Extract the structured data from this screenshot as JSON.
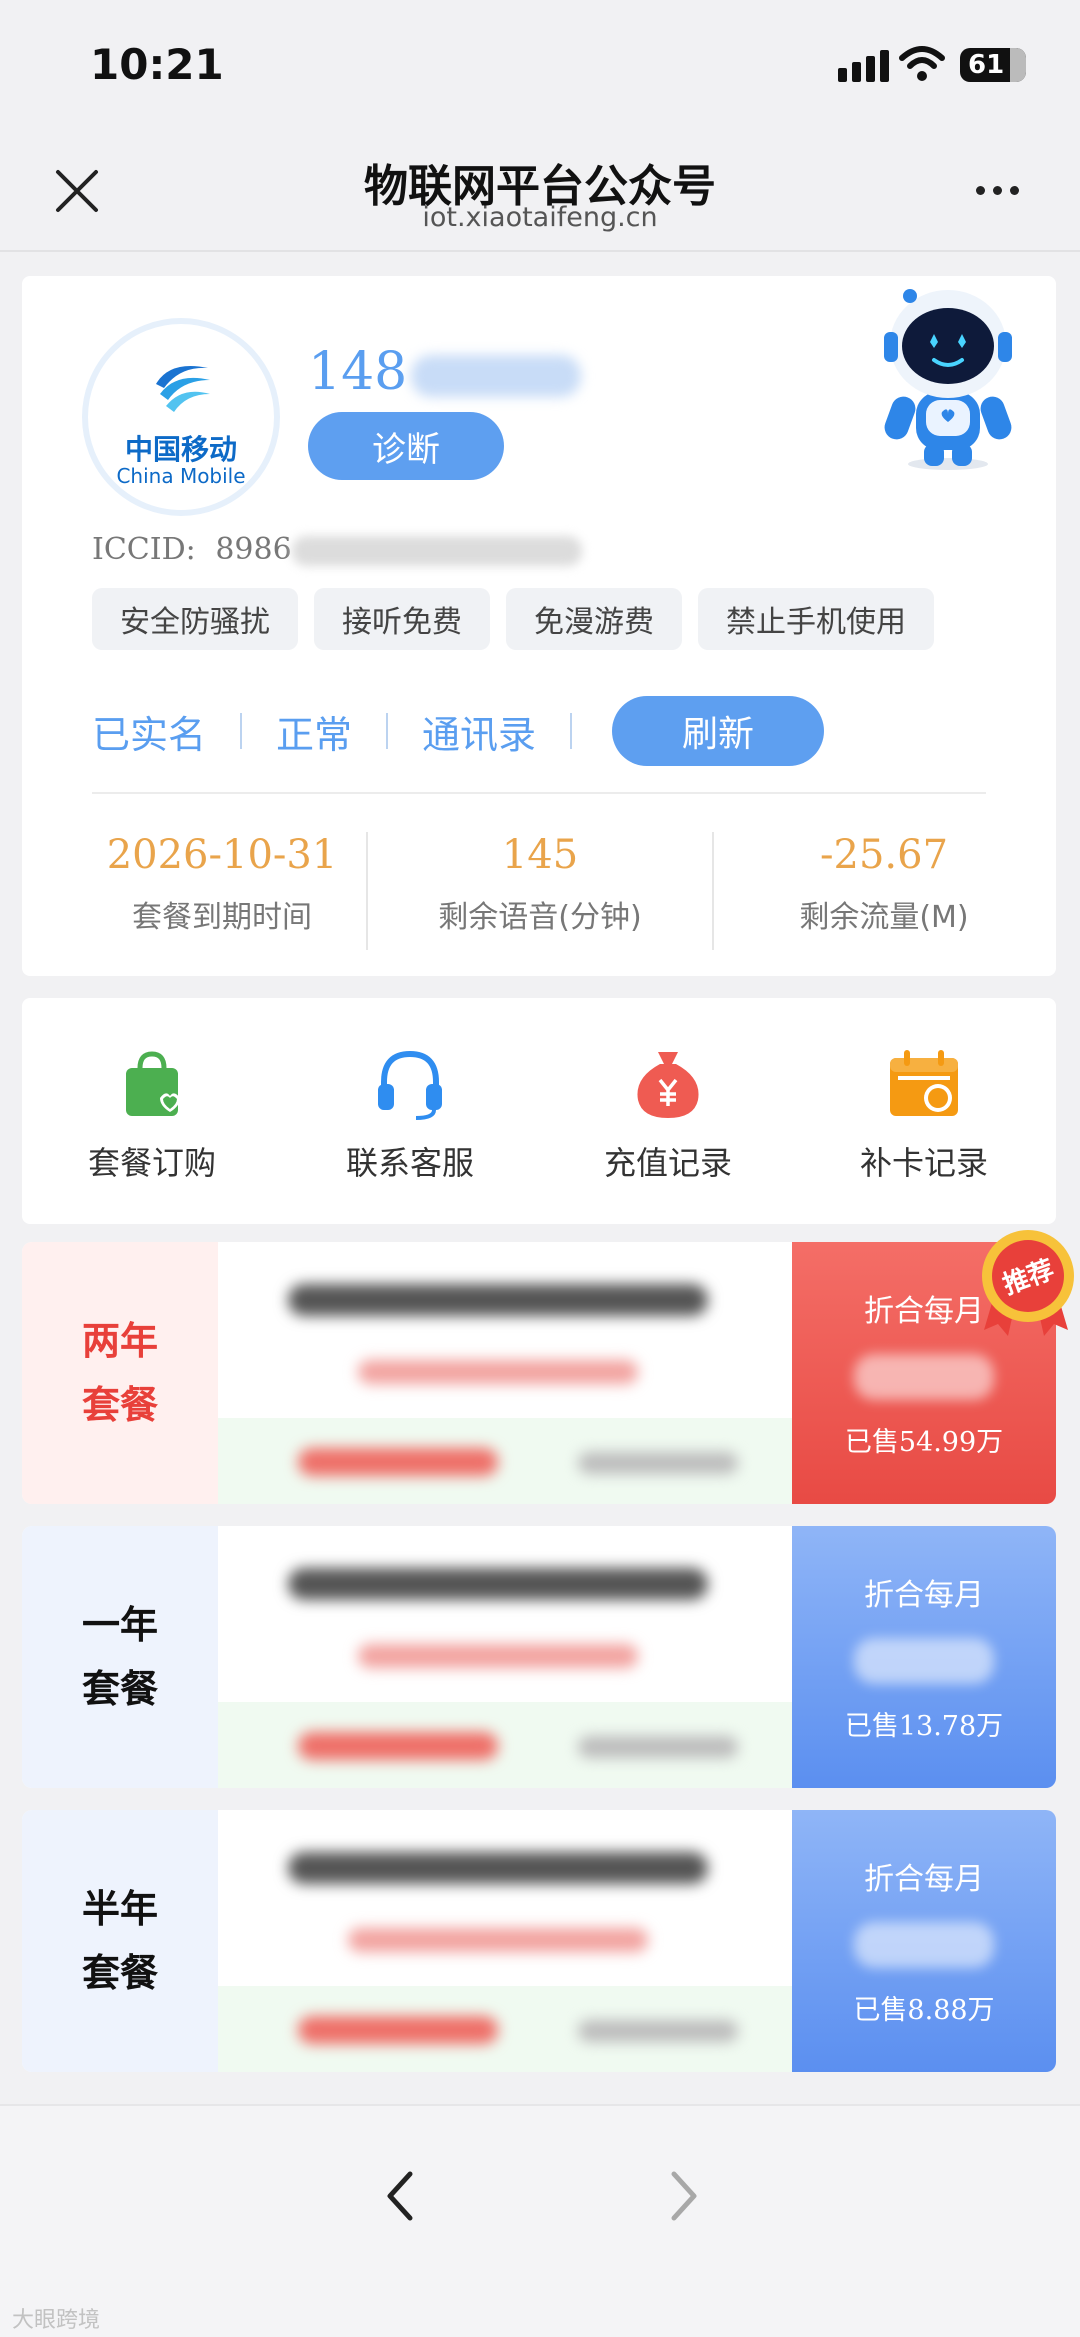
{
  "status_bar": {
    "time": "10:21",
    "battery": "61",
    "icons": [
      "signal-icon",
      "wifi-icon",
      "battery-icon"
    ]
  },
  "nav": {
    "title": "物联网平台公众号",
    "url": "iot.xiaotaifeng.cn",
    "close_icon": "close-icon",
    "more_icon": "more-icon"
  },
  "card": {
    "logo_cn": "中国移动",
    "logo_en": "China Mobile",
    "phone_prefix": "148",
    "diagnose_label": "诊断",
    "iccid_label": "ICCID:",
    "iccid_prefix": "8986",
    "tags": [
      "安全防骚扰",
      "接听免费",
      "免漫游费",
      "禁止手机使用"
    ],
    "status": [
      "已实名",
      "正常",
      "通讯录"
    ],
    "refresh_label": "刷新",
    "stats": [
      {
        "value": "2026-10-31",
        "label": "套餐到期时间"
      },
      {
        "value": "145",
        "label": "剩余语音(分钟)"
      },
      {
        "value": "-25.67",
        "label": "剩余流量(M)"
      }
    ]
  },
  "actions": [
    {
      "label": "套餐订购",
      "icon": "shopping-bag-icon",
      "color": "#4caf50"
    },
    {
      "label": "联系客服",
      "icon": "headset-icon",
      "color": "#2f8df0"
    },
    {
      "label": "充值记录",
      "icon": "money-bag-icon",
      "color": "#ef5b52"
    },
    {
      "label": "补卡记录",
      "icon": "calendar-icon",
      "color": "#f59a12"
    }
  ],
  "packages": [
    {
      "name_line1": "两年",
      "name_line2": "套餐",
      "per_month_label": "折合每月",
      "sold": "已售54.99万",
      "badge": "推荐",
      "accent": "#e8403a"
    },
    {
      "name_line1": "一年",
      "name_line2": "套餐",
      "per_month_label": "折合每月",
      "sold": "已售13.78万",
      "accent": "#5b8ff0"
    },
    {
      "name_line1": "半年",
      "name_line2": "套餐",
      "per_month_label": "折合每月",
      "sold": "已售8.88万",
      "accent": "#5b8ff0"
    }
  ],
  "bottom": {
    "watermark": "大眼跨境",
    "back_icon": "chevron-left-icon",
    "forward_icon": "chevron-right-icon"
  }
}
